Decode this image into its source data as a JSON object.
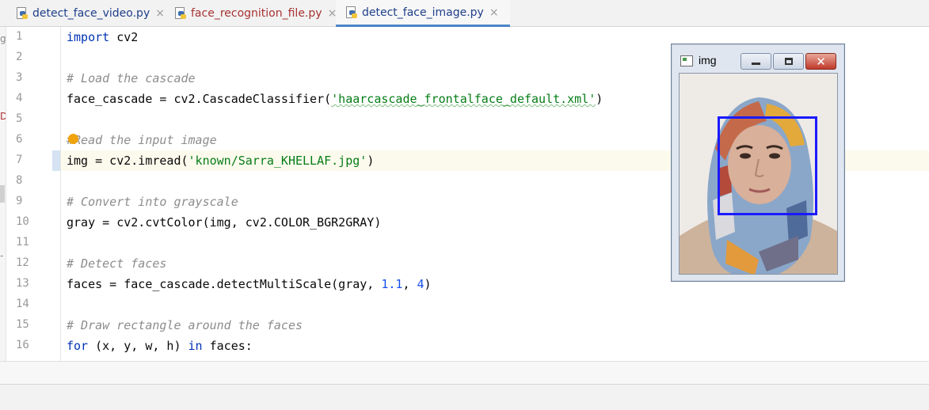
{
  "tabs": [
    {
      "label": "detect_face_video.py",
      "active": false,
      "color": "#1f3f8a"
    },
    {
      "label": "face_recognition_file.py",
      "active": false,
      "color": "#a83232"
    },
    {
      "label": "detect_face_image.py",
      "active": true,
      "color": "#1f3f8a"
    }
  ],
  "close_glyph": "×",
  "line_numbers": [
    "1",
    "2",
    "3",
    "4",
    "5",
    "6",
    "7",
    "8",
    "9",
    "10",
    "11",
    "12",
    "13",
    "14",
    "15",
    "16"
  ],
  "code": {
    "l1_kw": "import",
    "l1_rest": " cv2",
    "l3": "# Load the cascade",
    "l4_pre": "face_cascade = cv2.CascadeClassifier(",
    "l4_str": "'haarcascade_frontalface_default.xml'",
    "l4_post": ")",
    "l6_a": "#",
    "l6_b": "Read the input image",
    "l7_pre": "img = cv2.imread(",
    "l7_str": "'known/Sarra_KHELLAF.jpg'",
    "l7_post": ")",
    "l9": "# Convert into grayscale",
    "l10": "gray = cv2.cvtColor(img, cv2.COLOR_BGR2GRAY)",
    "l12": "# Detect faces",
    "l13_pre": "faces = face_cascade.detectMultiScale(gray, ",
    "l13_n1": "1.1",
    "l13_mid": ", ",
    "l13_n2": "4",
    "l13_post": ")",
    "l15": "# Draw rectangle around the faces",
    "l16_kw1": "for",
    "l16_mid": " (x, y, w, h) ",
    "l16_kw2": "in",
    "l16_post": " faces:"
  },
  "edge_marks": [
    "g",
    "D",
    "-"
  ],
  "image_window": {
    "title": "img",
    "minimize_icon": "minimize-icon",
    "maximize_icon": "maximize-icon",
    "close_glyph": "✕"
  }
}
